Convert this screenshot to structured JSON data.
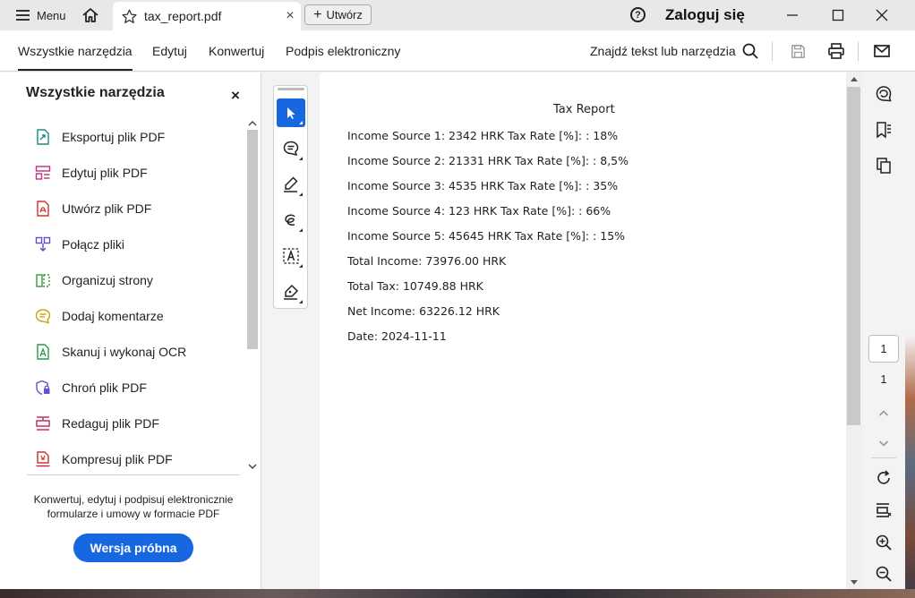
{
  "titlebar": {
    "menu_label": "Menu",
    "tab_title": "tax_report.pdf",
    "tab_close": "×",
    "create_label": "Utwórz",
    "help_glyph": "?",
    "login_label": "Zaloguj się"
  },
  "toolbar": {
    "tabs": [
      "Wszystkie narzędzia",
      "Edytuj",
      "Konwertuj",
      "Podpis elektroniczny"
    ],
    "active_tab": "Wszystkie narzędzia",
    "find_label": "Znajdź tekst lub narzędzia"
  },
  "left_panel": {
    "title": "Wszystkie narzędzia",
    "close": "×",
    "tools": [
      {
        "label": "Eksportuj plik PDF",
        "icon": "export-pdf-icon",
        "color": "#1a8a8a"
      },
      {
        "label": "Edytuj plik PDF",
        "icon": "edit-pdf-icon",
        "color": "#c0307a"
      },
      {
        "label": "Utwórz plik PDF",
        "icon": "create-pdf-icon",
        "color": "#d03030"
      },
      {
        "label": "Połącz pliki",
        "icon": "combine-files-icon",
        "color": "#5a4fd0"
      },
      {
        "label": "Organizuj strony",
        "icon": "organize-pages-icon",
        "color": "#3a9a3a"
      },
      {
        "label": "Dodaj komentarze",
        "icon": "comment-icon",
        "color": "#d0a000"
      },
      {
        "label": "Skanuj i wykonaj OCR",
        "icon": "scan-ocr-icon",
        "color": "#2a9a4a"
      },
      {
        "label": "Chroń plik PDF",
        "icon": "protect-pdf-icon",
        "color": "#6a4fd0"
      },
      {
        "label": "Redaguj plik PDF",
        "icon": "redact-pdf-icon",
        "color": "#c0306a"
      },
      {
        "label": "Kompresuj plik PDF",
        "icon": "compress-pdf-icon",
        "color": "#d03030"
      }
    ],
    "promo_text": "Konwertuj, edytuj i podpisuj elektronicznie formularze i umowy w formacie PDF",
    "trial_label": "Wersja próbna"
  },
  "document": {
    "title": "Tax Report",
    "lines": [
      "Income Source 1: 2342 HRK Tax Rate [%]: : 18%",
      "Income Source 2: 21331 HRK Tax Rate [%]: : 8,5%",
      "Income Source 3: 4535 HRK Tax Rate [%]: : 35%",
      "Income Source 4: 123 HRK Tax Rate [%]: : 66%",
      "Income Source 5: 45645 HRK Tax Rate [%]: : 15%",
      "Total Income: 73976.00 HRK",
      "Total Tax: 10749.88 HRK",
      "Net Income: 63226.12 HRK",
      "Date: 2024-11-11"
    ]
  },
  "right_rail": {
    "current_page": "1",
    "total_pages": "1"
  },
  "colors": {
    "accent": "#1767e0",
    "selected_tool": "#1767e0"
  }
}
